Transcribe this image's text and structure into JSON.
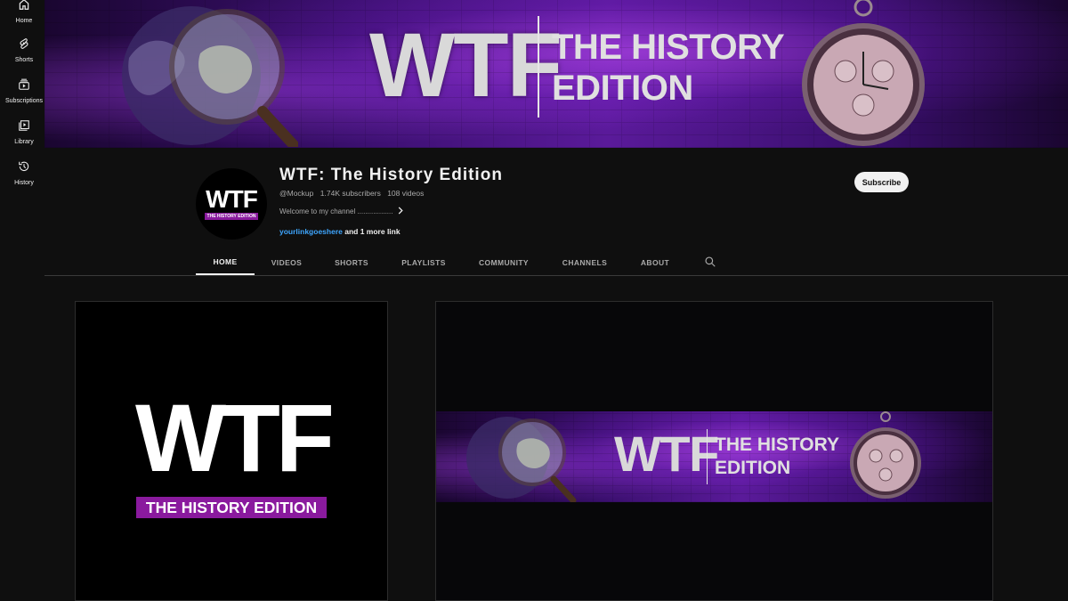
{
  "sidebar": {
    "items": [
      {
        "label": "Home",
        "icon": "home-icon"
      },
      {
        "label": "Shorts",
        "icon": "shorts-icon"
      },
      {
        "label": "Subscriptions",
        "icon": "subscriptions-icon"
      },
      {
        "label": "Library",
        "icon": "library-icon"
      },
      {
        "label": "History",
        "icon": "history-icon"
      }
    ]
  },
  "banner": {
    "left_text": "WTF",
    "right_line1": "THE HISTORY",
    "right_line2": "EDITION",
    "accent": "#5a1a9a"
  },
  "channel": {
    "avatar_big": "WTF",
    "avatar_small": "THE HISTORY EDITION",
    "name": "WTF: The History Edition",
    "handle": "@Mockup",
    "subscribers": "1.74K subscribers",
    "videos": "108 videos",
    "description": "Welcome to my channel ..................",
    "link": "yourlinkgoeshere",
    "more_links": "and 1 more link"
  },
  "subscribe_label": "Subscribe",
  "tabs": [
    {
      "label": "HOME",
      "active": true
    },
    {
      "label": "VIDEOS",
      "active": false
    },
    {
      "label": "SHORTS",
      "active": false
    },
    {
      "label": "PLAYLISTS",
      "active": false
    },
    {
      "label": "COMMUNITY",
      "active": false
    },
    {
      "label": "CHANNELS",
      "active": false
    },
    {
      "label": "ABOUT",
      "active": false
    }
  ],
  "logo_preview": {
    "big": "WTF",
    "strip": "THE HISTORY EDITION",
    "strip_color": "#8a1a9e"
  },
  "banner_preview": {
    "left_text": "WTF",
    "right_line1": "THE HISTORY",
    "right_line2": "EDITION"
  },
  "colors": {
    "background": "#0f0f0f",
    "link": "#3ea6ff",
    "text": "#f1f1f1",
    "muted": "#aaaaaa"
  }
}
